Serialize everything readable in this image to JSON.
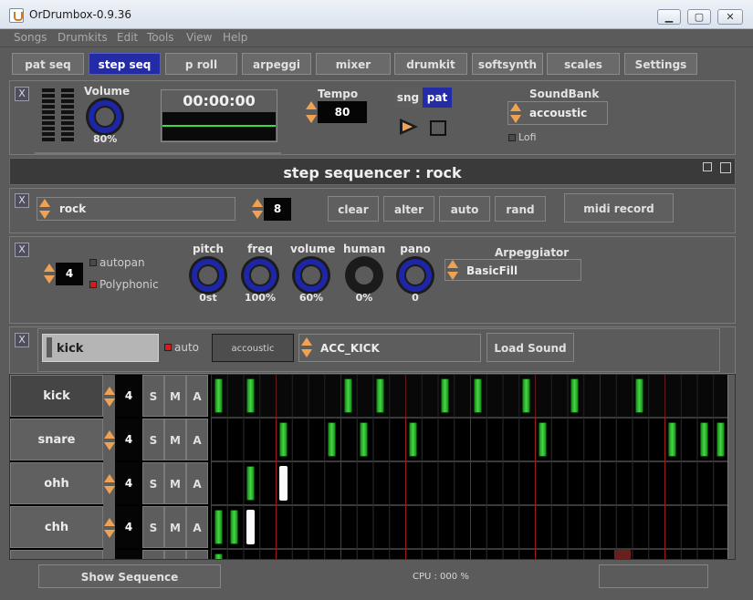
{
  "window": {
    "title": "OrDrumbox-0.9.36",
    "minimize": "▁",
    "maximize": "▢",
    "close": "✕"
  },
  "menu": [
    "Songs",
    "Drumkits",
    "Edit",
    "Tools",
    "View",
    "Help"
  ],
  "tabs": [
    "pat seq",
    "step seq",
    "p roll",
    "arpeggi",
    "mixer",
    "drumkit",
    "softsynth",
    "scales",
    "Settings"
  ],
  "transport": {
    "close": "X",
    "volume_label": "Volume",
    "volume_value": "80%",
    "time": "00:00:00",
    "tempo_label": "Tempo",
    "tempo": "80",
    "song_btn": "sng",
    "pattern_btn": "pat",
    "soundbank_label": "SoundBank",
    "soundbank": "accoustic",
    "lofi_label": "Lofi"
  },
  "step_sequencer": {
    "title": "step sequencer : rock",
    "pattern_close": "X",
    "pattern_name": "rock",
    "pattern_length": "8",
    "clear": "clear",
    "alter": "alter",
    "auto": "auto",
    "rand": "rand",
    "midi_record": "midi record"
  },
  "instrument": {
    "close": "X",
    "voices": "4",
    "autopan_label": "autopan",
    "polyphonic_label": "Polyphonic",
    "knobs": [
      {
        "label": "pitch",
        "value": "0st"
      },
      {
        "label": "freq",
        "value": "100%"
      },
      {
        "label": "volume",
        "value": "60%"
      },
      {
        "label": "human",
        "value": "0%"
      },
      {
        "label": "pano",
        "value": "0"
      }
    ],
    "arpeggiator_label": "Arpeggiator",
    "arpeggiator": "BasicFill"
  },
  "sound": {
    "close": "X",
    "instrument_name": "kick",
    "auto_label": "auto",
    "bank": "accoustic",
    "sample": "ACC_KICK",
    "load_sound": "Load Sound"
  },
  "tracks": [
    {
      "name": "kick",
      "value": "4",
      "s": "S",
      "m": "M",
      "a": "A"
    },
    {
      "name": "snare",
      "value": "4",
      "s": "S",
      "m": "M",
      "a": "A"
    },
    {
      "name": "ohh",
      "value": "4",
      "s": "S",
      "m": "M",
      "a": "A"
    },
    {
      "name": "chh",
      "value": "4",
      "s": "S",
      "m": "M",
      "a": "A"
    }
  ],
  "status": {
    "show_sequence": "Show Sequence",
    "cpu": "CPU : 000 %"
  },
  "colors": {
    "accent_blue": "#242ba6",
    "step_green": "#39c939",
    "bar_red": "#9b1c1c",
    "panel_gray": "#5b5b5b"
  }
}
